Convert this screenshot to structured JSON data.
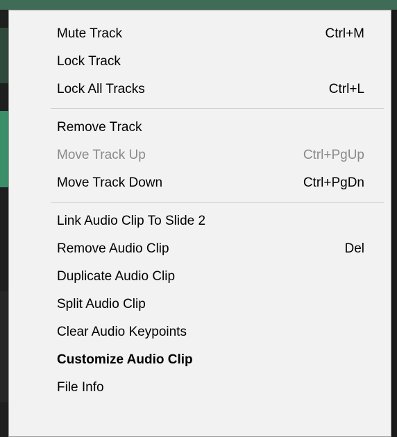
{
  "menu": {
    "group1": [
      {
        "label": "Mute Track",
        "shortcut": "Ctrl+M"
      },
      {
        "label": "Lock Track",
        "shortcut": ""
      },
      {
        "label": "Lock All Tracks",
        "shortcut": "Ctrl+L"
      }
    ],
    "group2": [
      {
        "label": "Remove Track",
        "shortcut": ""
      },
      {
        "label": "Move Track Up",
        "shortcut": "Ctrl+PgUp",
        "disabled": true
      },
      {
        "label": "Move Track Down",
        "shortcut": "Ctrl+PgDn"
      }
    ],
    "group3": [
      {
        "label": "Link Audio Clip To Slide 2",
        "shortcut": ""
      },
      {
        "label": "Remove Audio Clip",
        "shortcut": "Del"
      },
      {
        "label": "Duplicate Audio Clip",
        "shortcut": ""
      },
      {
        "label": "Split Audio Clip",
        "shortcut": ""
      },
      {
        "label": "Clear Audio Keypoints",
        "shortcut": ""
      },
      {
        "label": "Customize Audio Clip",
        "shortcut": "",
        "bold": true
      },
      {
        "label": "File Info",
        "shortcut": ""
      }
    ]
  },
  "colors": {
    "menu_background": "#f2f2f2",
    "disabled_text": "#8a8a8a",
    "separator": "#cfcfcf"
  }
}
